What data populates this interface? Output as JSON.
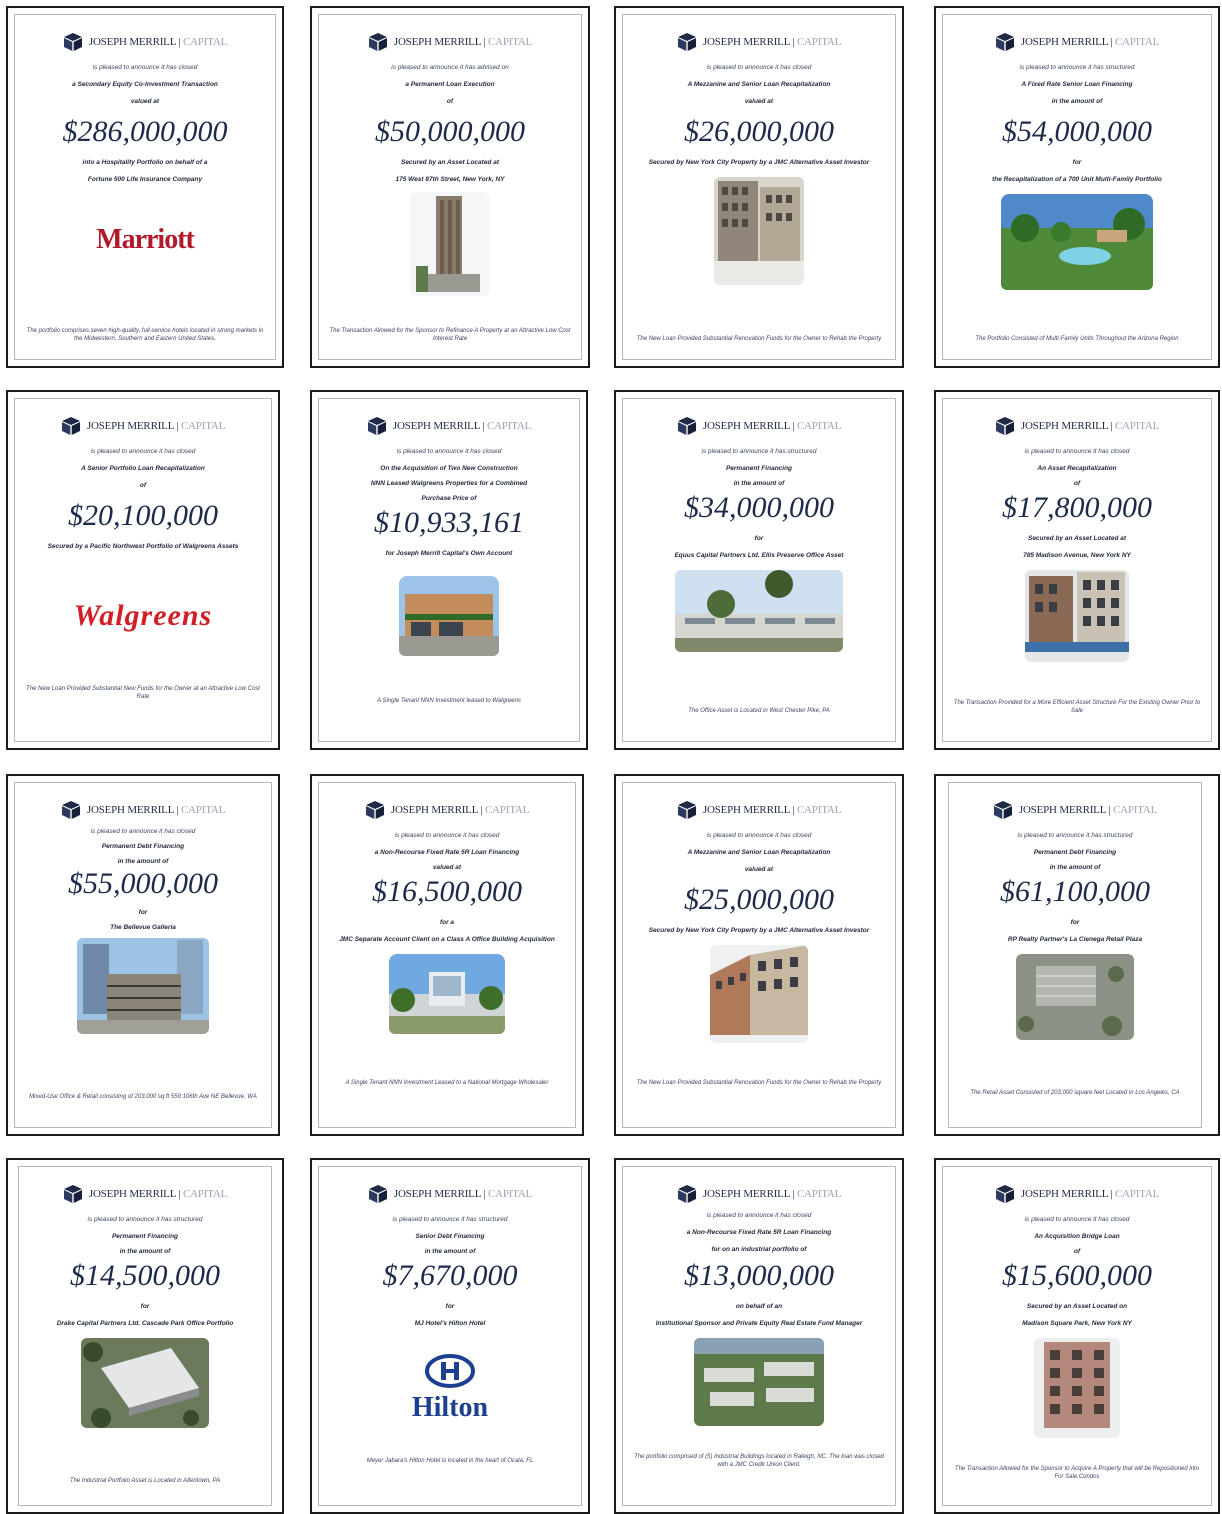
{
  "brand": {
    "name": "JOSEPH MERRILL",
    "divider": "|",
    "sub": "CAPITAL"
  },
  "cards": [
    {
      "l1": "is pleased to announce it has closed",
      "l2": "a Secondary Equity Co-Investment Transaction",
      "l3": "valued at",
      "amount": "$286,000,000",
      "l4": "into a Hospitality Portfolio on behalf of a",
      "l5": "Fortune 500 Life Insurance Company",
      "logo": "Marriott",
      "caption": "The portfolio comprises seven high-quality, full-service hotels located in strong markets in the Midwestern, Southern and Eastern United States."
    },
    {
      "l1": "is pleased to announce it has advised on",
      "l2": "a Permanent Loan Execution",
      "l3": "of",
      "amount": "$50,000,000",
      "l4": "Secured by an Asset Located at",
      "l5": "175 West 87th Street, New York, NY",
      "caption": "The Transaction Allowed for the Sponsor to Refinance A Property at an Attractive Low Cost Interest Rate"
    },
    {
      "l1": "is pleased to announce it has closed",
      "l2": "A Mezzanine and Senior Loan Recapitalization",
      "l3": "valued at",
      "amount": "$26,000,000",
      "l4": "Secured by New York City Property by a JMC Alternative Asset Investor",
      "caption": "The New Loan Provided Substantial Renovation Funds for the Owner to Rehab the Property"
    },
    {
      "l1": "is pleased to announce it has structured",
      "l2": "A Fixed Rate Senior Loan Financing",
      "l3": "in the amount of",
      "amount": "$54,000,000",
      "l4": "for",
      "l5": "the Recapitalization of a 700 Unit Multi-Family Portfolio",
      "caption": "The Portfolio Consisted of Multi-Family Units Throughout the Arizona Region"
    },
    {
      "l1": "is pleased to announce it has closed",
      "l2": "A Senior Portfolio Loan Recapitalization",
      "l3": "of",
      "amount": "$20,100,000",
      "l4": "Secured by a Pacific Northwest Portfolio of Walgreens Assets",
      "logo": "Walgreens",
      "caption": "The New Loan Provided Substantial New Funds for the Owner at an Attractive Low Cost Rate"
    },
    {
      "l1": "is pleased to announce it has closed",
      "l2": "On the Acquisition of Two New Construction",
      "l3": "NNN Leased Walgreens Properties for a Combined",
      "l3b": "Purchase Price of",
      "amount": "$10,933,161",
      "l4": "for Joseph Merrill Capital's Own Account",
      "caption": "A Single Tenant NNN Investment leased to Walgreens"
    },
    {
      "l1": "is pleased to announce it has structured",
      "l2": "Permanent Financing",
      "l3": "in the amount of",
      "amount": "$34,000,000",
      "l4": "for",
      "l5": "Equus Capital Partners Ltd. Ellis Preserve Office Asset",
      "caption": "The Office Asset is Located in West Chester Pike, PA"
    },
    {
      "l1": "is pleased to announce it has closed",
      "l2": "An Asset Recapitalization",
      "l3": "of",
      "amount": "$17,800,000",
      "l4": "Secured by an Asset Located at",
      "l5": "785 Madison Avenue, New York NY",
      "caption": "The Transaction Provided for a More Efficient Asset Structure For the Existing Owner Prior to Sale"
    },
    {
      "l1": "is pleased to announce it has closed",
      "l2": "Permanent Debt Financing",
      "l3": "in the amount of",
      "amount": "$55,000,000",
      "l4": "for",
      "l5": "The Bellevue Galleria",
      "caption": "Mixed-Use Office & Retail consisting of 203,000 sq ft 550 106th Ave NE Bellevue, WA"
    },
    {
      "l1": "is pleased to announce it has closed",
      "l2": "a Non-Recourse Fixed Rate 5R Loan Financing",
      "l3": "valued at",
      "amount": "$16,500,000",
      "l4": "for a",
      "l5": "JMC Separate Account Client on a Class A Office Building Acquisition",
      "caption": "A Single Tenant NNN Investment Leased to a National Mortgage Wholesaler"
    },
    {
      "l1": "is pleased to announce it has closed",
      "l2": "A Mezzanine and Senior Loan Recapitalization",
      "l3": "valued at",
      "amount": "$25,000,000",
      "l4": "Secured by New York City Property by a JMC Alternative Asset Investor",
      "caption": "The New Loan Provided Substantial Renovation Funds for the Owner to Rehab the Property"
    },
    {
      "l1": "is pleased to announce it has structured",
      "l2": "Permanent Debt Financing",
      "l3": "in the amount of",
      "amount": "$61,100,000",
      "l4": "for",
      "l5": "RP Realty Partner's La Cienega Retail Plaza",
      "caption": "The Retail Asset Consisted of 203,000 square feet Located in Los Angeles, CA"
    },
    {
      "l1": "is pleased to announce it has structured",
      "l2": "Permanent Financing",
      "l3": "in the amount of",
      "amount": "$14,500,000",
      "l4": "for",
      "l5": "Drake Capital Partners Ltd. Cascade Park Office Portfolio",
      "caption": "The Industrial Portfolio Asset is Located in Allentown, PA"
    },
    {
      "l1": "is pleased to announce it has structured",
      "l2": "Senior Debt Financing",
      "l3": "in the amount of",
      "amount": "$7,670,000",
      "l4": "for",
      "l5": "MJ Hotel's Hilton Hotel",
      "logo": "Hilton",
      "caption": "Meyer Jabara's Hilton Hotel is located in the heart of Ocala, FL"
    },
    {
      "l1": "is pleased to announce it has closed",
      "l2": "a Non-Recourse Fixed Rate 5R Loan Financing",
      "l3": "for on an industrial portfolio of",
      "amount": "$13,000,000",
      "l4": "on behalf of an",
      "l5": "Institutional Sponsor and Private Equity Real Estate Fund Manager",
      "caption": "The portfolio comprised of (5) Industrial Buildings located in Raleigh, NC. The loan was closed with a JMC Credit Union Client."
    },
    {
      "l1": "is pleased to announce it has closed",
      "l2": "An Acquisition Bridge Loan",
      "l3": "of",
      "amount": "$15,600,000",
      "l4": "Secured by an Asset Located on",
      "l5": "Madison Square Park, New York NY",
      "caption": "The Transaction Allowed for the Sponsor to Acquire A Property that will be Repositioned into For Sale Condos"
    }
  ]
}
